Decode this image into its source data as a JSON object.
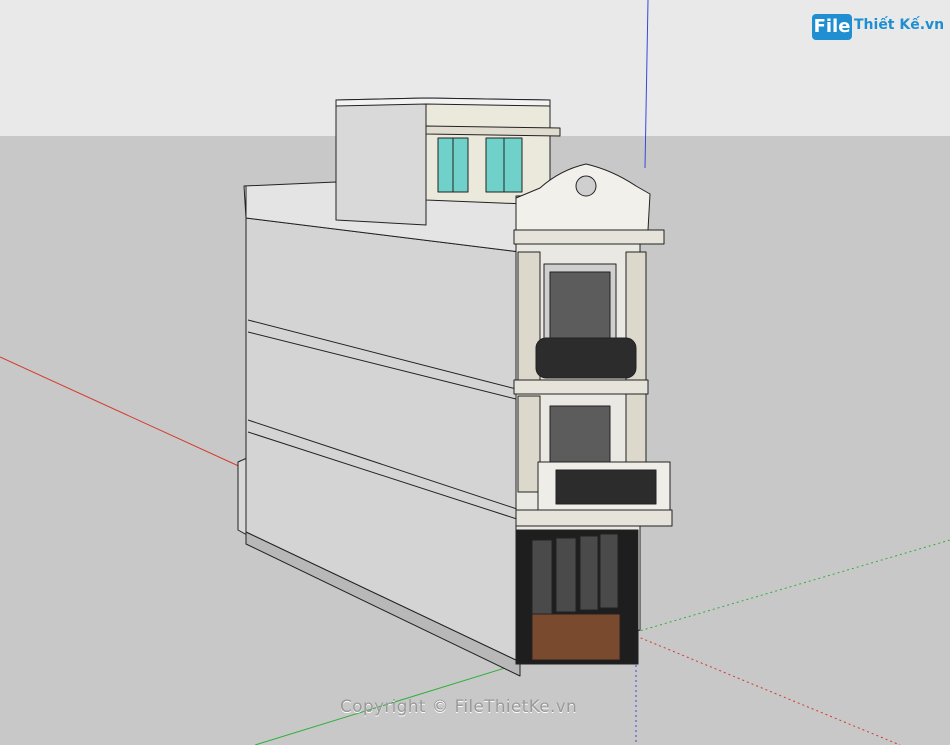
{
  "viewport": {
    "sky_color": "#e9e9e9",
    "ground_color": "#c8c8c8",
    "axis_colors": {
      "red": "#d33a2c",
      "green": "#2fae3d",
      "blue": "#3848d8"
    }
  },
  "watermark": {
    "logo_file": "File",
    "logo_rest": "Thiết Kế.vn",
    "brand_color": "#1f8fd1",
    "copyright": "Copyright © FileThietKe.vn"
  },
  "building": {
    "model": "townhouse-3-storey-with-rooftop",
    "wall_color": "#d4d4d4",
    "facade_color": "#eae8e2",
    "window_glass_color": "#6fd1c9",
    "door_color": "#7a4a2f"
  }
}
